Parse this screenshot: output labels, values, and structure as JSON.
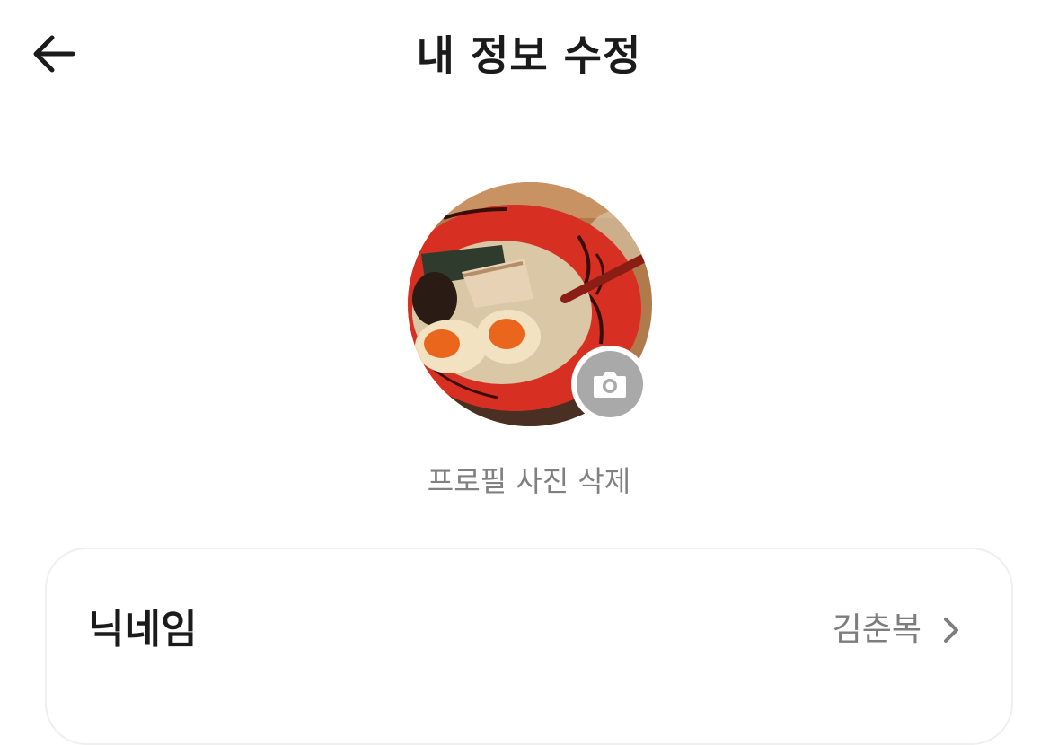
{
  "header": {
    "title": "내 정보 수정",
    "back_icon": "arrow-left-icon"
  },
  "profile": {
    "photo_description_icon": "profile-photo",
    "camera_icon": "camera-icon",
    "delete_photo_label": "프로필 사진 삭제"
  },
  "settings": {
    "rows": [
      {
        "label": "닉네임",
        "value": "김춘복",
        "icon": "chevron-right-icon"
      }
    ]
  },
  "colors": {
    "title_text": "#1b1b1b",
    "muted_text": "#808080",
    "camera_badge": "#a9a9a9",
    "card_border": "#efefef"
  }
}
